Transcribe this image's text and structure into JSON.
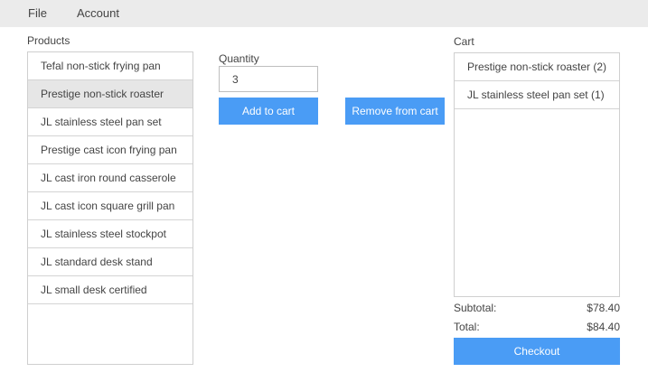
{
  "menu": {
    "file": "File",
    "account": "Account"
  },
  "products": {
    "label": "Products",
    "items": [
      {
        "label": "Tefal non-stick frying pan",
        "selected": false
      },
      {
        "label": "Prestige non-stick roaster",
        "selected": true
      },
      {
        "label": "JL stainless steel pan set",
        "selected": false
      },
      {
        "label": "Prestige cast icon frying pan",
        "selected": false
      },
      {
        "label": "JL cast iron round casserole",
        "selected": false
      },
      {
        "label": "JL cast icon square grill pan",
        "selected": false
      },
      {
        "label": "JL stainless steel stockpot",
        "selected": false
      },
      {
        "label": "JL standard desk stand",
        "selected": false
      },
      {
        "label": "JL small desk certified",
        "selected": false
      }
    ]
  },
  "quantity": {
    "label": "Quantity",
    "value": "3"
  },
  "buttons": {
    "add": "Add to cart",
    "remove": "Remove from cart",
    "checkout": "Checkout"
  },
  "cart": {
    "label": "Cart",
    "items": [
      {
        "label": "Prestige non-stick roaster (2)"
      },
      {
        "label": "JL stainless steel pan set (1)"
      }
    ]
  },
  "summary": {
    "subtotal_label": "Subtotal:",
    "subtotal_value": "$78.40",
    "total_label": "Total:",
    "total_value": "$84.40"
  },
  "colors": {
    "accent": "#4a9cf5",
    "menubar": "#ebebeb",
    "selected_row": "#e6e6e6"
  }
}
